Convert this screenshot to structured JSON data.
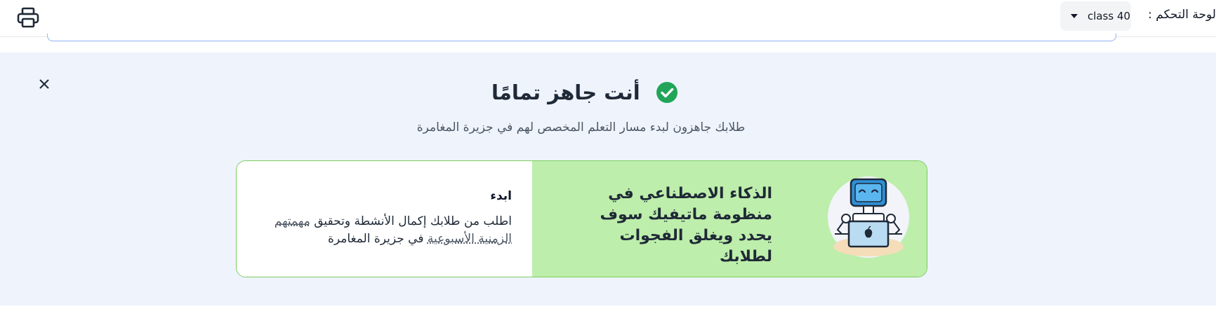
{
  "header": {
    "dashboard_label": "لوحة التحكم :",
    "class_select_value": "class 40",
    "print_icon": "printer-icon",
    "caret_icon": "caret-down-icon"
  },
  "banner": {
    "title": "أنت جاهز تمامًا",
    "check_icon": "check-circle-icon",
    "close_icon": "close-icon",
    "subtitle": "طلابك جاهزون لبدء مسار التعلم المخصص لهم في جزيرة المغامرة"
  },
  "card": {
    "ai_text": "الذكاء الاصطناعي في منظومة ماتيفيك سوف يحدد ويغلق الفجوات لطلابك",
    "robot_icon": "robot-laptop-illustration",
    "start_title": "ابدء",
    "start_text_before": "اطلب من طلابك إكمال الأنشطة وتحقيق ",
    "start_link": "مهمتهم الزمنية الأسبوعية",
    "start_text_after": " في جزيرة المغامرة"
  },
  "colors": {
    "banner_bg": "#eef3fc",
    "card_green": "#bdeeab",
    "card_border": "#7ccc5c",
    "check_green": "#22a559",
    "accent_blue": "#93b4f5"
  }
}
